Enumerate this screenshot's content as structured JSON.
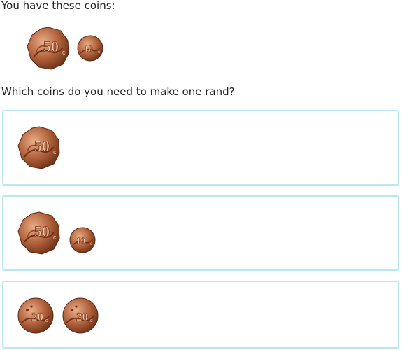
{
  "question": {
    "intro": "You have these coins:",
    "prompt": "Which coins do you need to make one rand?"
  },
  "available_coins": [
    {
      "value": "50",
      "unit": "c"
    },
    {
      "value": "10",
      "unit": "c"
    }
  ],
  "choices": [
    {
      "coins": [
        {
          "value": "50",
          "unit": "c"
        }
      ]
    },
    {
      "coins": [
        {
          "value": "50",
          "unit": "c"
        },
        {
          "value": "10",
          "unit": "c"
        }
      ]
    },
    {
      "coins": [
        {
          "value": "20",
          "unit": "c"
        },
        {
          "value": "20",
          "unit": "c"
        }
      ]
    }
  ],
  "colors": {
    "coin_dark": "#7a3a1e",
    "coin_mid": "#b2633d",
    "coin_light": "#e0a07a",
    "choice_border": "#b8e8f2"
  }
}
